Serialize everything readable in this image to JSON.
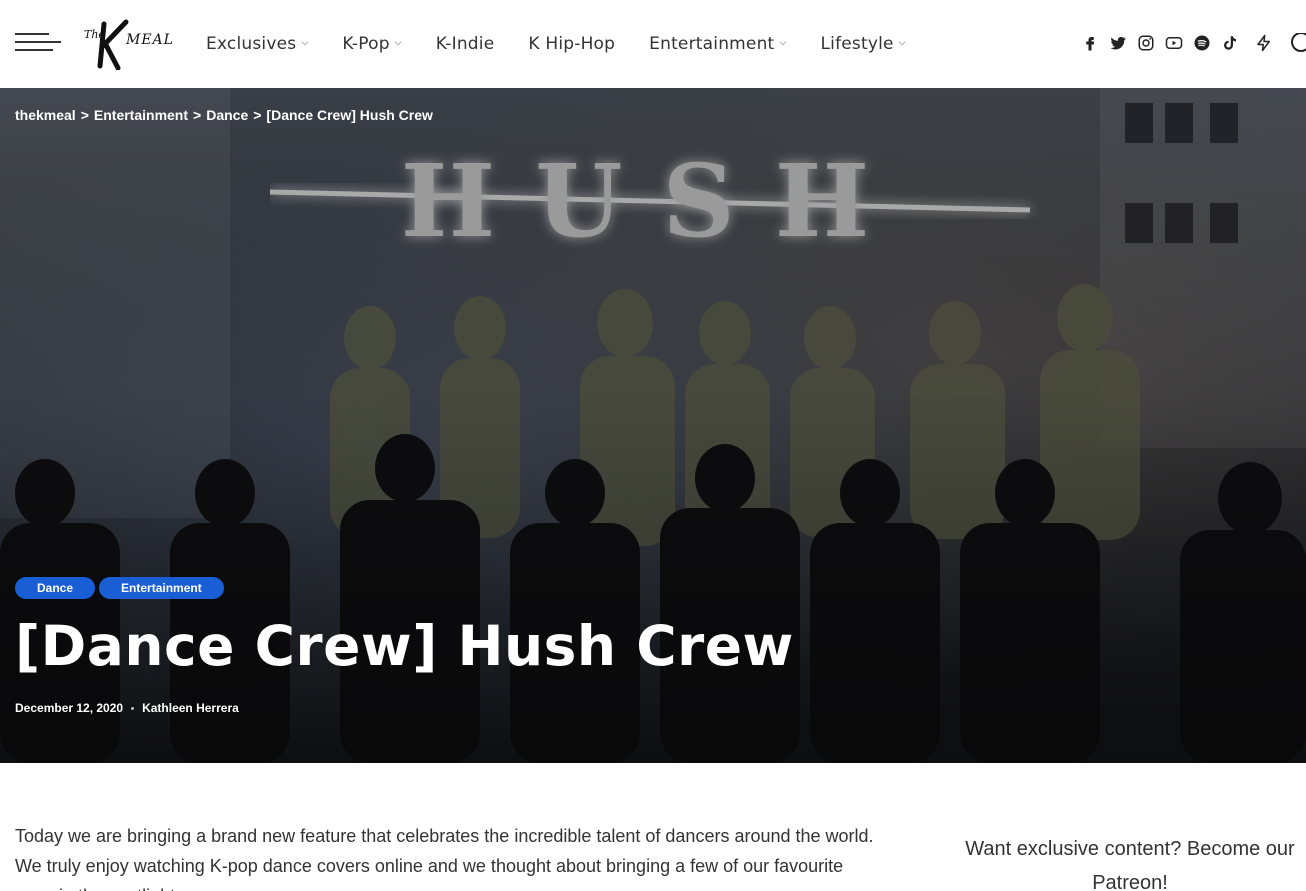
{
  "header": {
    "logo_text": "The K MEAL",
    "nav": [
      {
        "label": "Exclusives",
        "has_dropdown": true
      },
      {
        "label": "K-Pop",
        "has_dropdown": true
      },
      {
        "label": "K-Indie",
        "has_dropdown": false
      },
      {
        "label": "K Hip-Hop",
        "has_dropdown": false
      },
      {
        "label": "Entertainment",
        "has_dropdown": true
      },
      {
        "label": "Lifestyle",
        "has_dropdown": true
      }
    ],
    "social_icons": [
      "facebook-icon",
      "twitter-icon",
      "instagram-icon",
      "youtube-icon",
      "spotify-icon",
      "tiktok-icon",
      "lightning-icon",
      "search-icon"
    ]
  },
  "breadcrumb": {
    "items": [
      "thekmeal",
      "Entertainment",
      "Dance",
      "[Dance Crew] Hush Crew"
    ],
    "separator": ">"
  },
  "hero": {
    "image_logo_text": "HUSH",
    "categories": [
      "Dance",
      "Entertainment"
    ],
    "title": "[Dance Crew] Hush Crew",
    "date": "December 12, 2020",
    "author": "Kathleen Herrera"
  },
  "article": {
    "intro": "Today we are bringing a brand new feature that celebrates the incredible talent of dancers around the world. We truly enjoy watching K-pop dance covers online and we thought about bringing a few of our favourite ones in the spotlight."
  },
  "sidebar": {
    "promo_text": "Want exclusive content? Become our Patreon!"
  },
  "colors": {
    "accent": "#1a5ed6",
    "hero_text": "#ffffff",
    "body_text": "#333333"
  }
}
